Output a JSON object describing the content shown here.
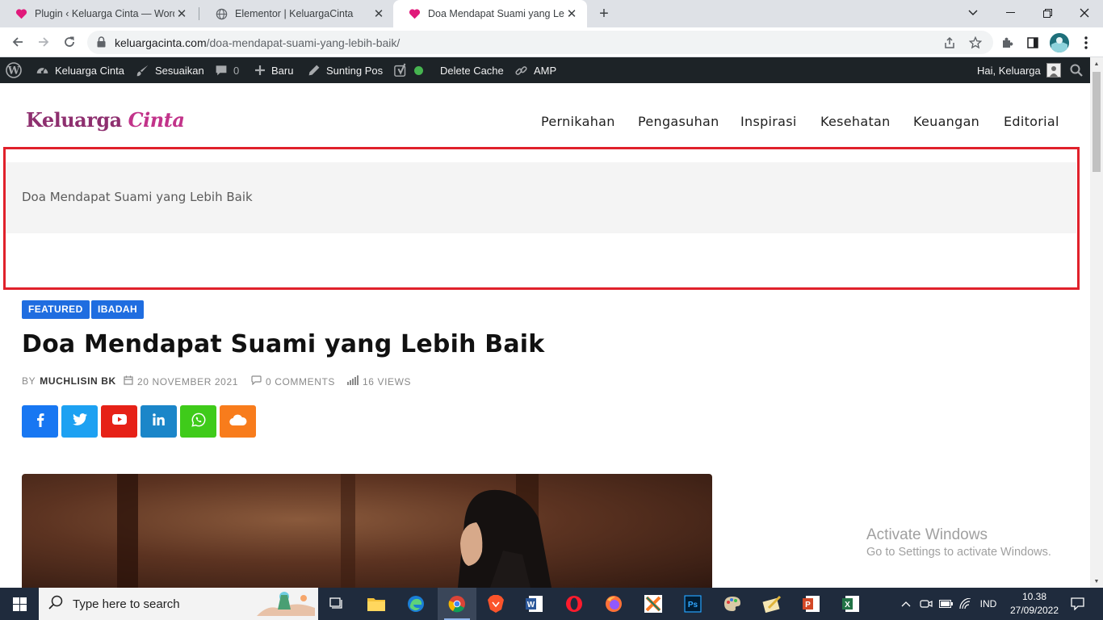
{
  "browser": {
    "tabs": [
      {
        "title": "Plugin ‹ Keluarga Cinta — WordPress",
        "icon": "heart-icon",
        "active": false
      },
      {
        "title": "Elementor | KeluargaCinta",
        "icon": "globe-icon",
        "active": false
      },
      {
        "title": "Doa Mendapat Suami yang Lebih Baik",
        "icon": "heart-icon",
        "active": true
      }
    ],
    "new_tab": "+",
    "url_host": "keluargacinta.com",
    "url_path": "/doa-mendapat-suami-yang-lebih-baik/"
  },
  "adminbar": {
    "site_name": "Keluarga Cinta",
    "customize": "Sesuaikan",
    "comments_count": "0",
    "new": "Baru",
    "edit_post": "Sunting Pos",
    "delete_cache": "Delete Cache",
    "amp": "AMP",
    "greeting": "Hai, Keluarga"
  },
  "site": {
    "logo_part1": "Keluarga",
    "logo_part2": "Cinta",
    "nav": [
      "Pernikahan",
      "Pengasuhan",
      "Inspirasi",
      "Kesehatan",
      "Keuangan",
      "Editorial"
    ]
  },
  "breadcrumb": {
    "current": "Doa Mendapat Suami yang Lebih Baik"
  },
  "article": {
    "categories": [
      "FEATURED",
      "IBADAH"
    ],
    "title": "Doa Mendapat Suami yang Lebih Baik",
    "by_label": "BY",
    "author": "MUCHLISIN BK",
    "date": "20 NOVEMBER 2021",
    "comments": "0 COMMENTS",
    "views": "16 VIEWS",
    "share": [
      {
        "name": "facebook",
        "color": "#1877f2",
        "glyph": "f"
      },
      {
        "name": "twitter",
        "color": "#1da1f2",
        "glyph": "twitter"
      },
      {
        "name": "youtube",
        "color": "#e62117",
        "glyph": "youtube"
      },
      {
        "name": "linkedin",
        "color": "#1b86c9",
        "glyph": "in"
      },
      {
        "name": "whatsapp",
        "color": "#3fcb1a",
        "glyph": "whatsapp"
      },
      {
        "name": "cloud",
        "color": "#f87c1c",
        "glyph": "cloud"
      }
    ]
  },
  "watermark": {
    "line1": "Activate Windows",
    "line2": "Go to Settings to activate Windows."
  },
  "taskbar": {
    "search_placeholder": "Type here to search",
    "language": "IND",
    "time": "10.38",
    "date": "27/09/2022"
  },
  "colors": {
    "adminbar": "#1d2327",
    "category_badge": "#1f6de0",
    "highlight_border": "#e0212b",
    "logo": "#8e2f6f"
  }
}
